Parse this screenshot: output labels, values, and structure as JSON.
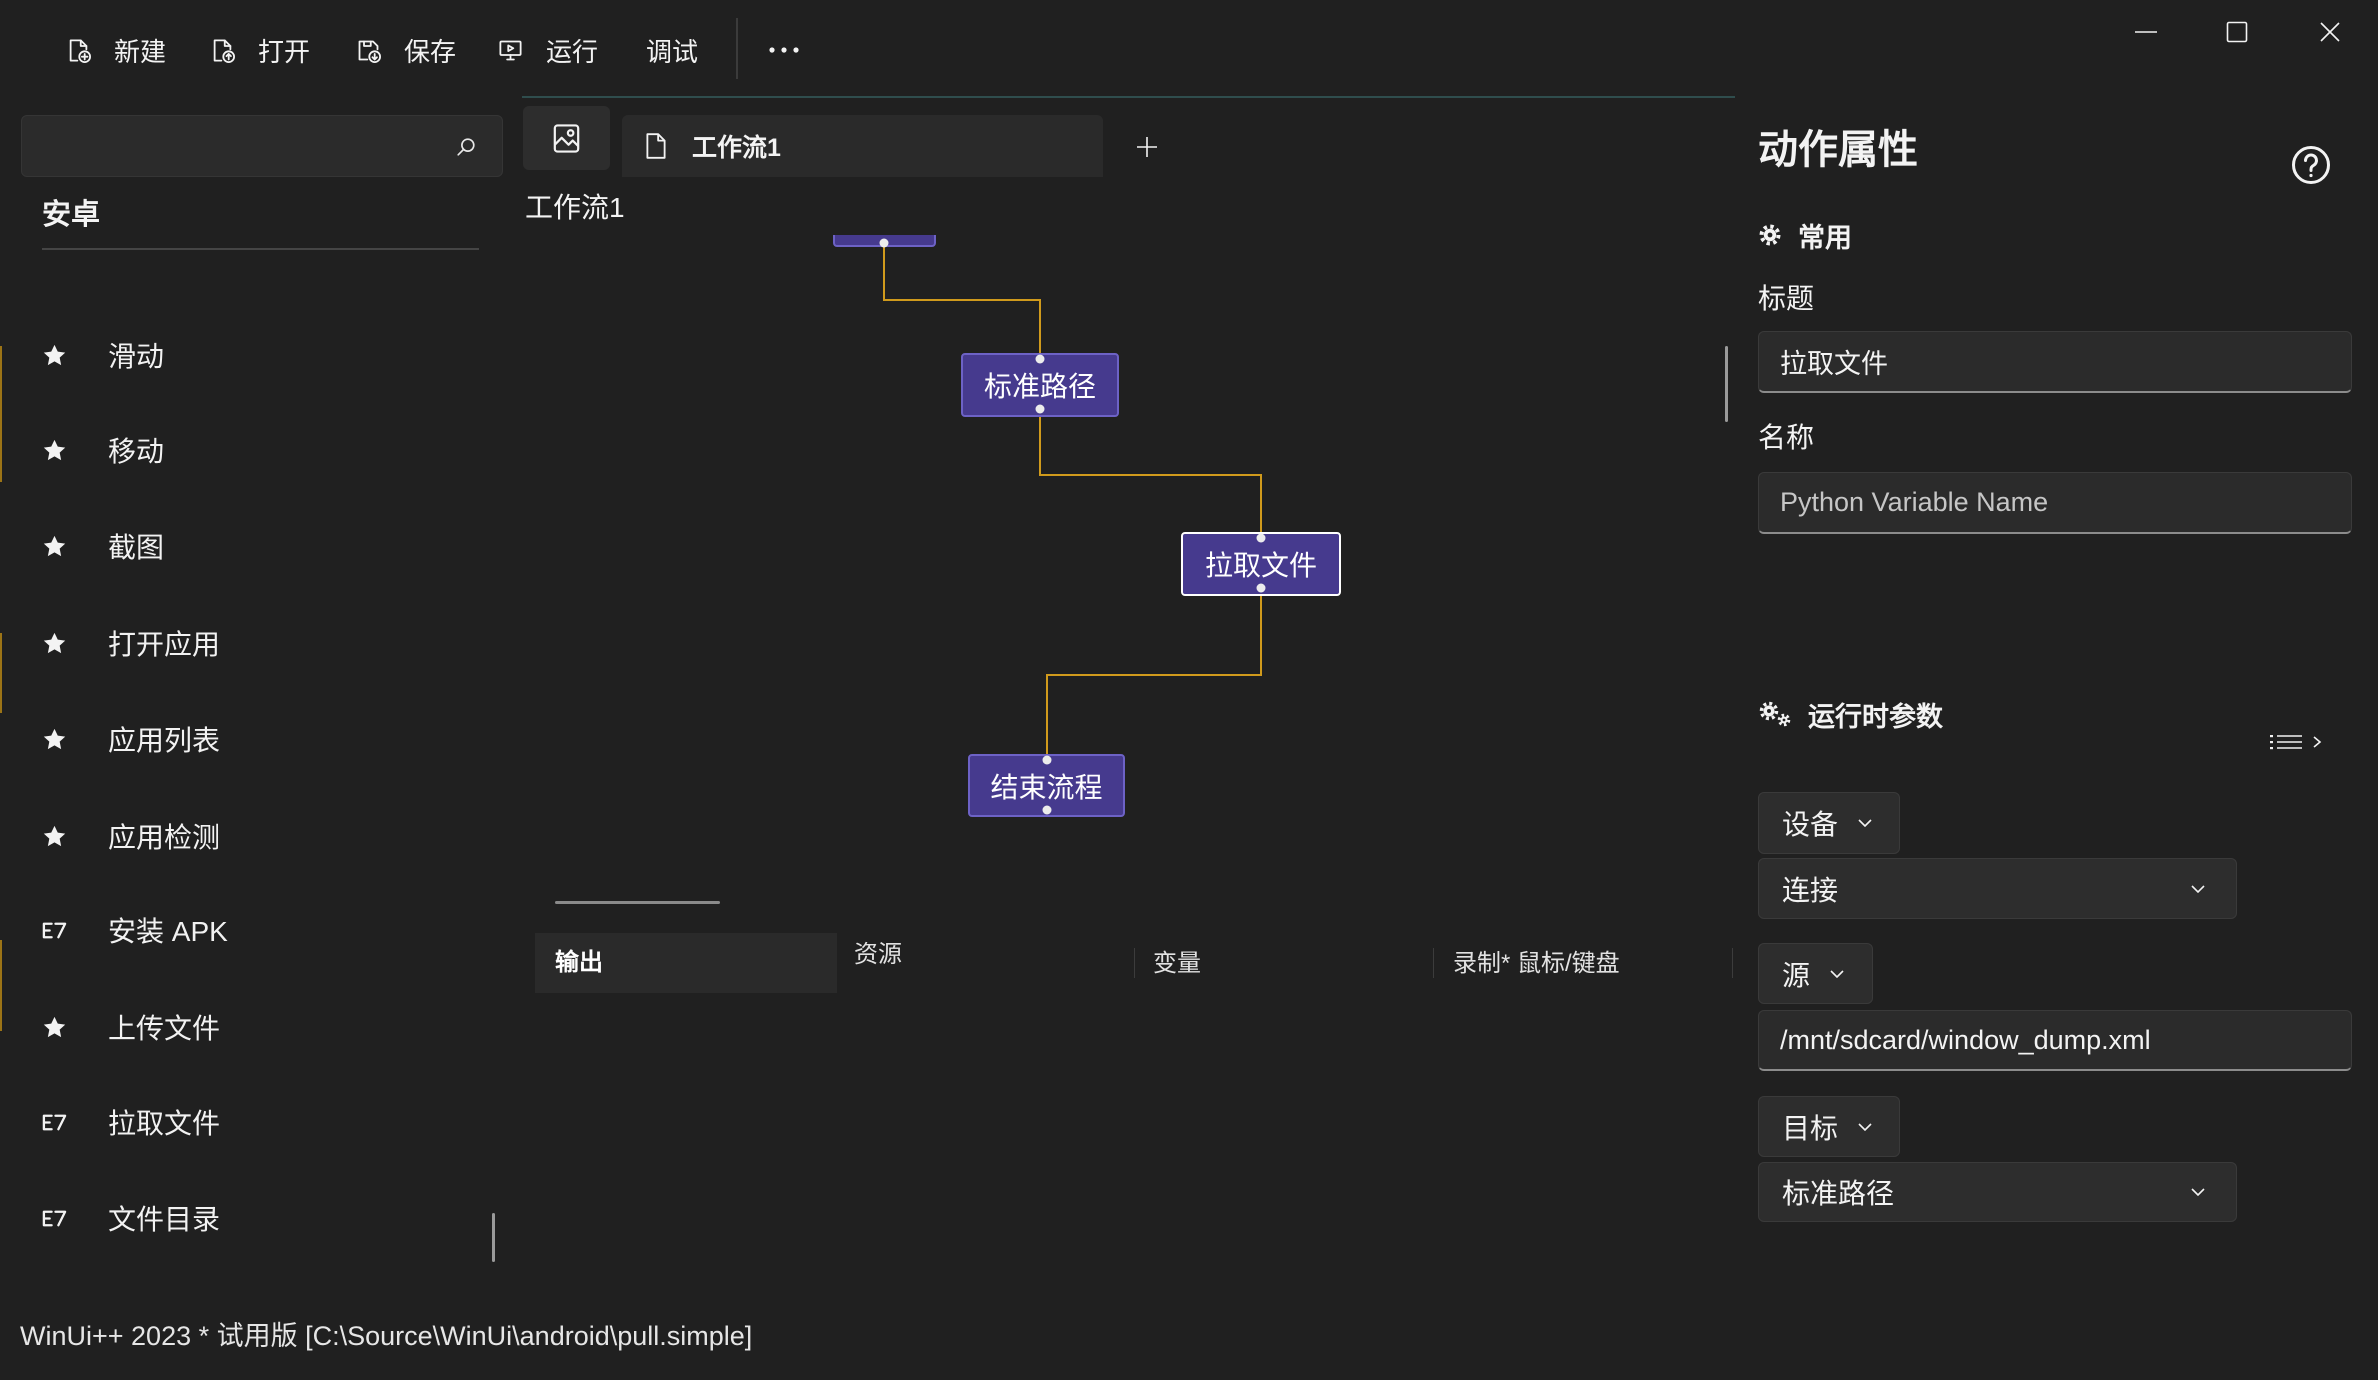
{
  "toolbar": {
    "new": {
      "label": "新建",
      "icon": "new-file-icon"
    },
    "open": {
      "label": "打开",
      "icon": "open-file-icon"
    },
    "save": {
      "label": "保存",
      "icon": "save-icon"
    },
    "run": {
      "label": "运行",
      "icon": "run-icon"
    },
    "debug": {
      "label": "调试"
    },
    "more_icon": "more-icon"
  },
  "window_controls": [
    "minimize-icon",
    "maximize-icon",
    "close-icon"
  ],
  "sidebar": {
    "search_icon": "search-icon",
    "section_title": "安卓",
    "items": [
      {
        "label": "滑动",
        "icon": "star-icon"
      },
      {
        "label": "移动",
        "icon": "star-icon"
      },
      {
        "label": "截图",
        "icon": "star-icon"
      },
      {
        "label": "打开应用",
        "icon": "star-icon"
      },
      {
        "label": "应用列表",
        "icon": "star-icon"
      },
      {
        "label": "应用检测",
        "icon": "star-icon"
      },
      {
        "label": "安装 APK",
        "icon": "script-icon"
      },
      {
        "label": "上传文件",
        "icon": "star-icon"
      },
      {
        "label": "拉取文件",
        "icon": "script-icon"
      },
      {
        "label": "文件目录",
        "icon": "script-icon"
      }
    ]
  },
  "editor": {
    "view_toggle_icon": "image-icon",
    "tabs": [
      {
        "label": "工作流1",
        "icon": "document-icon"
      }
    ],
    "add_tab_icon": "plus-icon",
    "workflow_title": "工作流1",
    "nodes": [
      {
        "label": "标准路径",
        "selected": false
      },
      {
        "label": "拉取文件",
        "selected": true
      },
      {
        "label": "结束流程",
        "selected": false
      }
    ],
    "bottom_tabs": [
      {
        "label": "输出",
        "active": true
      },
      {
        "label": "资源",
        "active": false
      },
      {
        "label": "变量",
        "active": false
      },
      {
        "label": "录制* 鼠标/键盘",
        "active": false
      }
    ]
  },
  "properties": {
    "title": "动作属性",
    "help_icon": "help-icon",
    "common": {
      "icon": "gear-icon",
      "heading": "常用",
      "title_label": "标题",
      "title_value": "拉取文件",
      "name_label": "名称",
      "name_placeholder": "Python Variable Name"
    },
    "runtime": {
      "icon": "gears-icon",
      "heading": "运行时参数",
      "view_icon": "list-icon",
      "device": {
        "label": "设备",
        "value": "连接"
      },
      "source": {
        "label": "源",
        "value": "/mnt/sdcard/window_dump.xml"
      },
      "target": {
        "label": "目标",
        "value": "标准路径"
      }
    }
  },
  "status_bar": {
    "text": "WinUi++ 2023 * 试用版 [C:\\Source\\WinUi\\android\\pull.simple]"
  },
  "colors": {
    "background": "#202020",
    "panel": "#2b2b2b",
    "node_fill": "#463a8e",
    "node_border": "#6d62c6",
    "node_selected_border": "#ffffff",
    "connector": "#d09a1c",
    "accent_line": "#2f4d4d"
  }
}
